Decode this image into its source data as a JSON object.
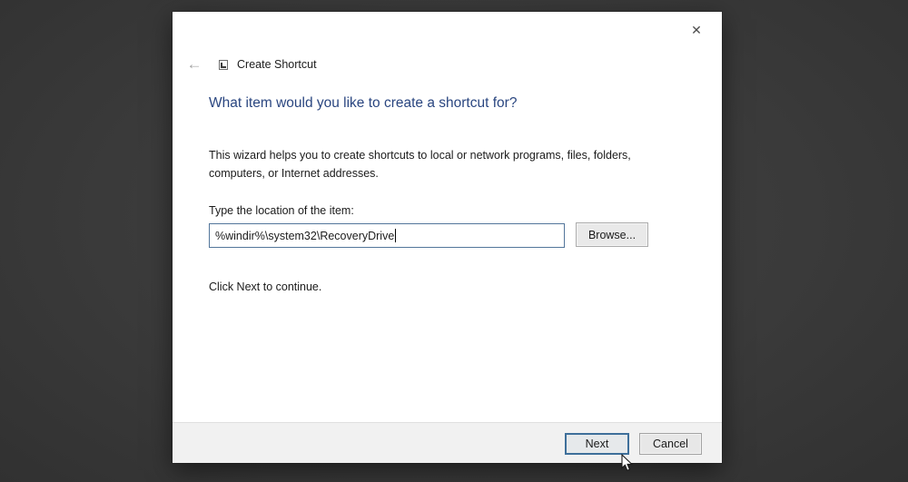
{
  "window": {
    "nav": {
      "back_icon": "←",
      "title": "Create Shortcut"
    },
    "close_icon": "✕",
    "heading": "What item would you like to create a shortcut for?",
    "description": {
      "line1": "This wizard helps you to create shortcuts to local or network programs, files, folders,",
      "line2": "computers, or Internet addresses."
    },
    "location_field": {
      "label": "Type the location of the item:",
      "value": "%windir%\\system32\\RecoveryDrive",
      "browse_label": "Browse..."
    },
    "hint": "Click Next to continue.",
    "footer": {
      "next_label": "Next",
      "cancel_label": "Cancel"
    }
  },
  "colors": {
    "backdrop": "#3a3a3a",
    "dialog_bg": "#ffffff",
    "footer_bg": "#f1f1f1",
    "heading_blue": "#2a4680",
    "input_focus_border": "#53769b",
    "default_button_border": "#3e6f9a"
  }
}
